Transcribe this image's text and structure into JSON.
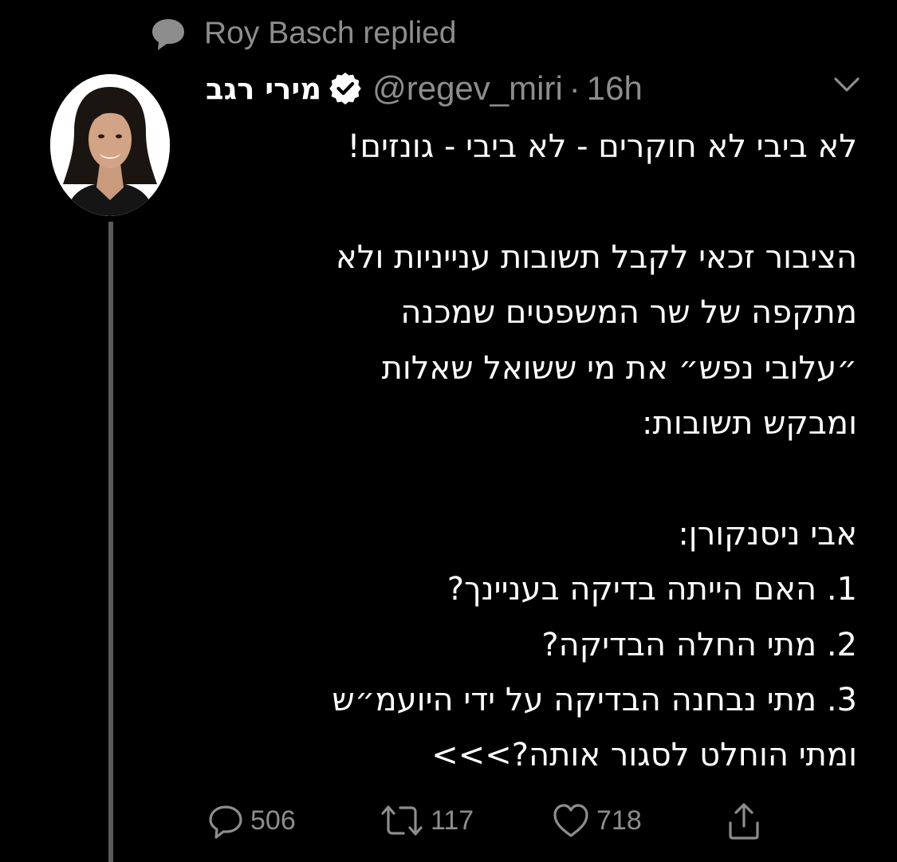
{
  "context": {
    "icon": "speech-bubble-icon",
    "text": "Roy Basch replied"
  },
  "tweet": {
    "author": {
      "display_name": "מירי רגב",
      "handle": "@regev_miri",
      "verified_icon": "verified-badge-icon",
      "avatar": "avatar-photo"
    },
    "separator": "·",
    "time": "16h",
    "menu_icon": "chevron-down-icon",
    "lines": [
      "לא ביבי לא חוקרים - לא ביבי - גונזים!",
      "",
      "הציבור זכאי לקבל תשובות ענייניות ולא",
      "מתקפה של שר המשפטים שמכנה",
      "״עלובי נפש״ את מי ששואל שאלות",
      "ומבקש תשובות:",
      "",
      "אבי ניסנקורן:",
      "1. האם הייתה בדיקה בעניינך?",
      "2. מתי החלה הבדיקה?",
      "3. מתי נבחנה הבדיקה על ידי היועמ״ש",
      "ומתי הוחלט לסגור אותה?>>>"
    ]
  },
  "actions": {
    "reply": {
      "icon": "reply-icon",
      "count": "506"
    },
    "retweet": {
      "icon": "retweet-icon",
      "count": "117"
    },
    "like": {
      "icon": "heart-icon",
      "count": "718"
    },
    "share": {
      "icon": "share-icon"
    }
  },
  "colors": {
    "background": "#000000",
    "text": "#ffffff",
    "secondary": "#8d8d8d",
    "thread_line": "#5c5c5c"
  }
}
